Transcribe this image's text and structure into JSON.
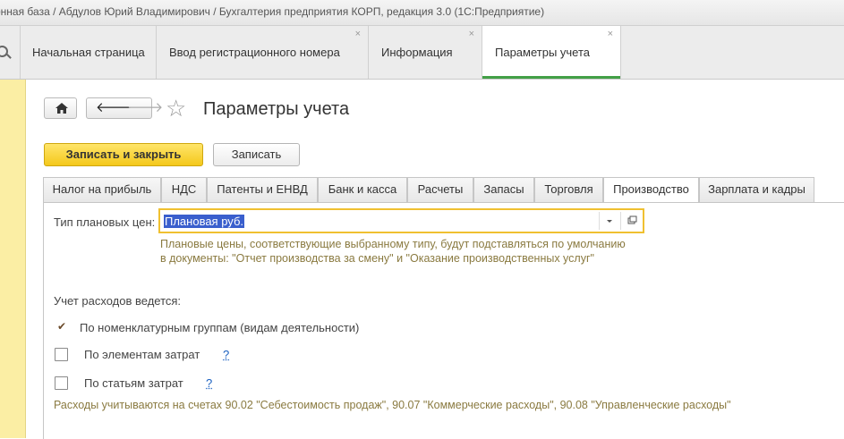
{
  "window": {
    "title": "онная база / Абдулов Юрий Владимирович / Бухгалтерия предприятия КОРП, редакция 3.0  (1С:Предприятие)"
  },
  "tabs": [
    {
      "label": "Начальная страница",
      "closable": false
    },
    {
      "label": "Ввод регистрационного номера",
      "closable": true
    },
    {
      "label": "Информация",
      "closable": true
    },
    {
      "label": "Параметры учета",
      "closable": true,
      "active": true
    }
  ],
  "close_glyph": "×",
  "nav": {
    "back": "🡐",
    "forward": "🡒",
    "star": "☆"
  },
  "form": {
    "title": "Параметры учета",
    "save_close_label": "Записать и закрыть",
    "save_label": "Записать"
  },
  "form_tabs": [
    "Налог на прибыль",
    "НДС",
    "Патенты и ЕНВД",
    "Банк и касса",
    "Расчеты",
    "Запасы",
    "Торговля",
    "Производство",
    "Зарплата и кадры"
  ],
  "active_form_tab": "Производство",
  "production": {
    "price_type_label": "Тип плановых цен:",
    "price_type_value": "Плановая руб.",
    "hint_line1": "Плановые цены, соответствующие выбранному типу, будут подставляться по умолчанию",
    "hint_line2": "в документы: \"Отчет производства за смену\" и \"Оказание производственных услуг\"",
    "costs_heading": "Учет расходов ведется:",
    "option_groups": "По номенклатурным группам (видам деятельности)",
    "option_elements": "По элементам затрат",
    "option_items": "По статьям затрат",
    "help_mark": "?",
    "accounts_note": "Расходы учитываются на счетах 90.02 \"Себестоимость продаж\", 90.07 \"Коммерческие расходы\", 90.08 \"Управленческие расходы\"",
    "groups_checked": true,
    "elements_checked": false,
    "items_checked": false
  }
}
